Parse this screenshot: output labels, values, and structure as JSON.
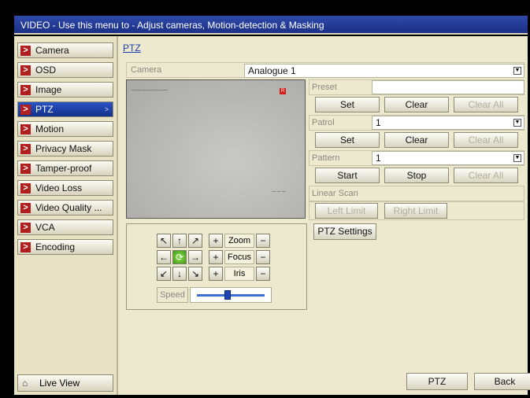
{
  "window": {
    "title": "VIDEO - Use this menu to - Adjust cameras, Motion-detection & Masking"
  },
  "sidebar": {
    "items": [
      {
        "label": "Camera"
      },
      {
        "label": "OSD"
      },
      {
        "label": "Image"
      },
      {
        "label": "PTZ",
        "active": true
      },
      {
        "label": "Motion"
      },
      {
        "label": "Privacy Mask"
      },
      {
        "label": "Tamper-proof"
      },
      {
        "label": "Video Loss"
      },
      {
        "label": "Video Quality ..."
      },
      {
        "label": "VCA"
      },
      {
        "label": "Encoding"
      }
    ],
    "live_view_label": "Live View"
  },
  "main": {
    "breadcrumb": "PTZ",
    "camera_label": "Camera",
    "camera_value": "Analogue 1",
    "preset": {
      "label": "Preset",
      "value": "",
      "set": "Set",
      "clear": "Clear",
      "clear_all": "Clear All"
    },
    "patrol": {
      "label": "Patrol",
      "value": "1",
      "set": "Set",
      "clear": "Clear",
      "clear_all": "Clear All"
    },
    "pattern": {
      "label": "Pattern",
      "value": "1",
      "start": "Start",
      "stop": "Stop",
      "clear_all": "Clear All"
    },
    "linear_scan": {
      "label": "Linear Scan",
      "left_limit": "Left Limit",
      "right_limit": "Right Limit"
    },
    "ptz_settings": "PTZ Settings",
    "ptz_control": {
      "zoom": "Zoom",
      "focus": "Focus",
      "iris": "Iris",
      "speed_label": "Speed",
      "speed_level": 0.45,
      "plus": "+",
      "minus": "−",
      "arrows": {
        "up_left": "↖",
        "up": "↑",
        "up_right": "↗",
        "left": "←",
        "right": "→",
        "down_left": "↙",
        "down": "↓",
        "down_right": "↘"
      }
    },
    "preview_rec_badge": "R"
  },
  "footer": {
    "ptz_button": "PTZ",
    "back_button": "Back"
  },
  "colors": {
    "title_bar": "#1b2f86",
    "active_item": "#14318a",
    "panel": "#ede9cf",
    "arrow_red": "#b01e1e"
  }
}
